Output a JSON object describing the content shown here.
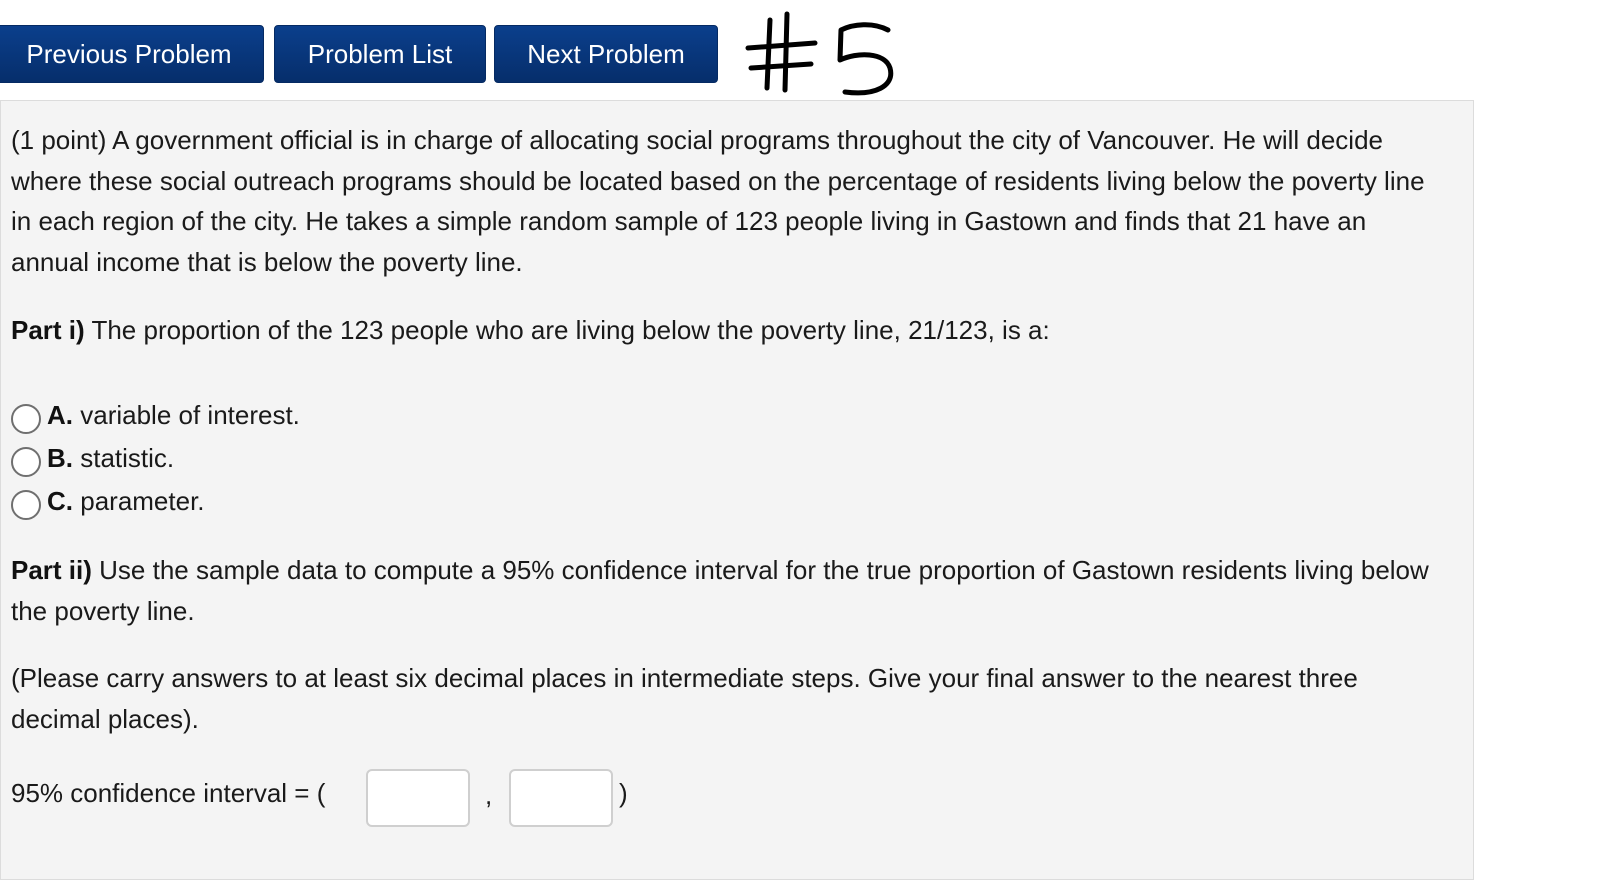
{
  "nav": {
    "previous_label": "Previous Problem",
    "list_label": "Problem List",
    "next_label": "Next Problem"
  },
  "annotation": {
    "handwritten": "#5"
  },
  "problem": {
    "intro": "(1 point) A government official is in charge of allocating social programs throughout the city of Vancouver. He will decide where these social outreach programs should be located based on the percentage of residents living below the poverty line in each region of the city. He takes a simple random sample of 123 people living in Gastown and finds that 21 have an annual income that is below the poverty line.",
    "part1": {
      "heading": "Part i)",
      "question": "The proportion of the 123 people who are living below the poverty line, 21/123, is a:",
      "options": [
        {
          "letter": "A.",
          "text": "variable of interest."
        },
        {
          "letter": "B.",
          "text": "statistic."
        },
        {
          "letter": "C.",
          "text": "parameter."
        }
      ]
    },
    "part2": {
      "heading": "Part ii)",
      "question": "Use the sample data to compute a 95% confidence interval for the true proportion of Gastown residents living below the poverty line.",
      "note": "(Please carry answers to at least six decimal places in intermediate steps. Give your final answer to the nearest three decimal places).",
      "ci_label": "95% confidence interval = (",
      "separator": ",",
      "close": ")",
      "lower_value": "",
      "upper_value": ""
    }
  }
}
